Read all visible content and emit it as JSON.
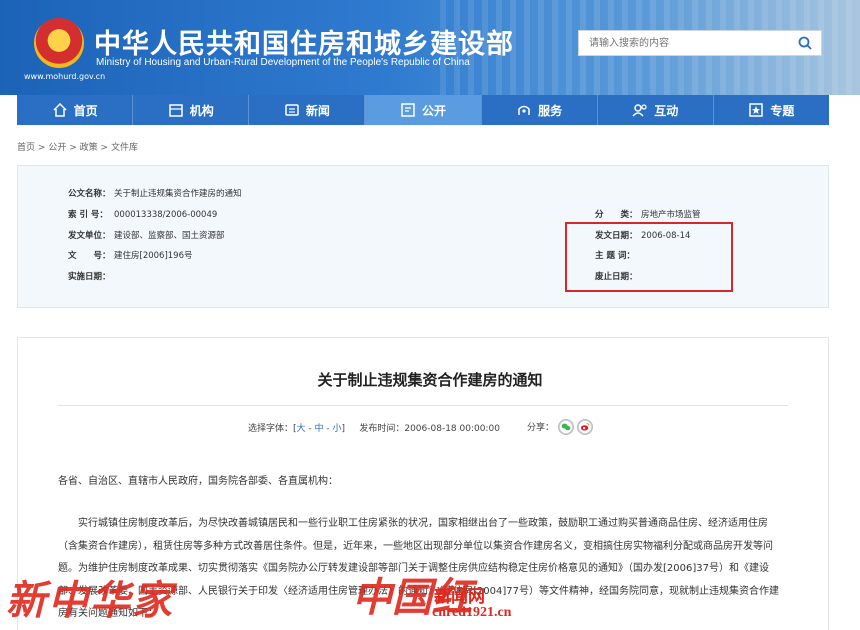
{
  "header": {
    "title_cn": "中华人民共和国住房和城乡建设部",
    "title_en": "Ministry of Housing and Urban-Rural Development of the People's Republic of China",
    "url": "www.mohurd.gov.cn",
    "search_placeholder": "请输入搜索的内容",
    "brand_color": "#2a6fc4"
  },
  "nav": [
    {
      "label": "首页",
      "icon": "home-icon"
    },
    {
      "label": "机构",
      "icon": "organization-icon"
    },
    {
      "label": "新闻",
      "icon": "news-icon"
    },
    {
      "label": "公开",
      "icon": "disclosure-icon",
      "active": true
    },
    {
      "label": "服务",
      "icon": "service-icon"
    },
    {
      "label": "互动",
      "icon": "interaction-icon"
    },
    {
      "label": "专题",
      "icon": "topic-icon"
    }
  ],
  "breadcrumb": {
    "home": "首页",
    "sep": ">",
    "c1": "公开",
    "c2": "政策",
    "c3": "文件库"
  },
  "info": {
    "doc_name_key": "公文名称：",
    "doc_name_val": "关于制止违规集资合作建房的通知",
    "index_key": "索 引 号：",
    "index_val": "000013338/2006-00049",
    "issuer_key": "发文单位：",
    "issuer_val": "建设部、监察部、国土资源部",
    "docno_key": "文　　号：",
    "docno_val": "建住房[2006]196号",
    "impl_key": "实施日期：",
    "impl_val": "",
    "category_key": "分　　类：",
    "category_val": "房地产市场监管",
    "date_key": "发文日期：",
    "date_val": "2006-08-14",
    "subject_key": "主 题 词：",
    "subject_val": "",
    "expire_key": "废止日期：",
    "expire_val": ""
  },
  "article": {
    "title": "关于制止违规集资合作建房的通知",
    "font_label": "选择字体：[",
    "font_large": "大",
    "font_mid": "中",
    "font_small": "小",
    "font_close": "]",
    "dash": " - ",
    "publish": "发布时间：2006-08-18 00:00:00",
    "share_label": "分享：",
    "salutation": "各省、自治区、直辖市人民政府，国务院各部委、各直属机构：",
    "paragraph": "实行城镇住房制度改革后，为尽快改善城镇居民和一些行业职工住房紧张的状况，国家相继出台了一些政策，鼓励职工通过购买普通商品住房、经济适用住房（含集资合作建房），租赁住房等多种方式改善居住条件。但是，近年来，一些地区出现部分单位以集资合作建房名义，变相搞住房实物福利分配或商品房开发等问题。为维护住房制度改革成果、切实贯彻落实《国务院办公厅转发建设部等部门关于调整住房供应结构稳定住房价格意见的通知》（国办发[2006]37号）和《建设部、发展改革委、国土资源部、人民银行关于印发〈经济适用住房管理办法〉的通知》（建住房[2004]77号）等文件精神，经国务院同意，现就制止违规集资合作建房有关问题通知如下："
  },
  "watermark": {
    "left": "新中华家",
    "mid": "中国红",
    "right_cn": "新闻网",
    "right_url": "cnred1921.cn"
  }
}
